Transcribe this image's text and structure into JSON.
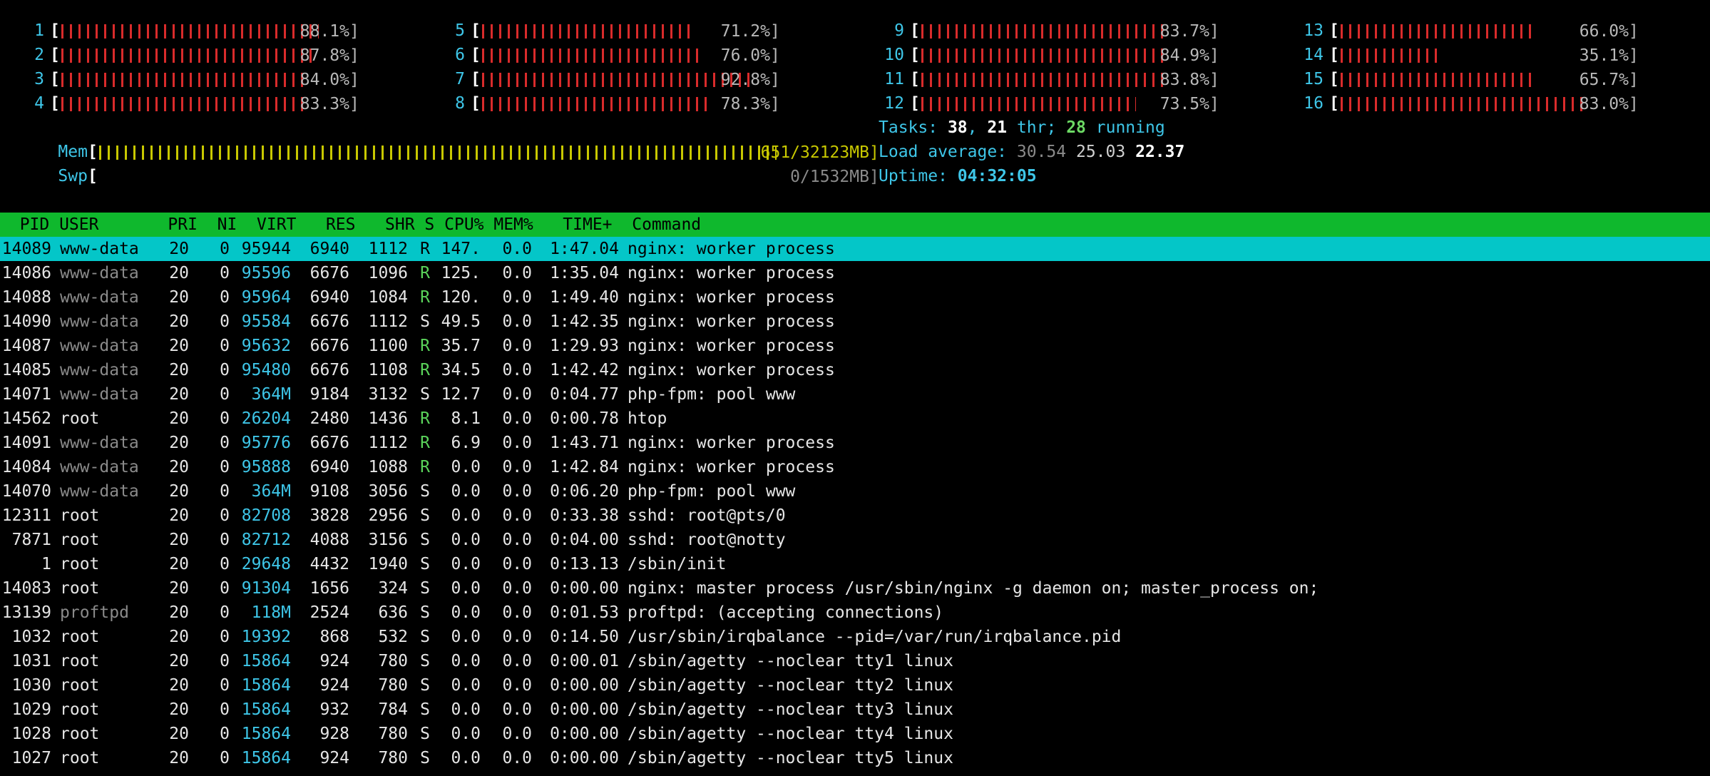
{
  "cpus": [
    {
      "n": "1",
      "pct": "88.1%]",
      "fill": 0.881
    },
    {
      "n": "2",
      "pct": "87.8%]",
      "fill": 0.878
    },
    {
      "n": "3",
      "pct": "84.0%]",
      "fill": 0.84
    },
    {
      "n": "4",
      "pct": "83.3%]",
      "fill": 0.833
    },
    {
      "n": "5",
      "pct": "71.2%]",
      "fill": 0.712
    },
    {
      "n": "6",
      "pct": "76.0%]",
      "fill": 0.76
    },
    {
      "n": "7",
      "pct": "92.8%]",
      "fill": 0.928
    },
    {
      "n": "8",
      "pct": "78.3%]",
      "fill": 0.783
    },
    {
      "n": "9",
      "pct": "83.7%]",
      "fill": 0.837
    },
    {
      "n": "10",
      "pct": "84.9%]",
      "fill": 0.849
    },
    {
      "n": "11",
      "pct": "83.8%]",
      "fill": 0.838
    },
    {
      "n": "12",
      "pct": "73.5%]",
      "fill": 0.735
    },
    {
      "n": "13",
      "pct": "66.0%]",
      "fill": 0.66
    },
    {
      "n": "14",
      "pct": "35.1%]",
      "fill": 0.351
    },
    {
      "n": "15",
      "pct": "65.7%]",
      "fill": 0.657
    },
    {
      "n": "16",
      "pct": "83.0%]",
      "fill": 0.83
    }
  ],
  "mem": {
    "label": "Mem",
    "value": "651/32123MB]",
    "fill": 0.99
  },
  "swp": {
    "label": "Swp",
    "value": "0/1532MB]",
    "fill": 0
  },
  "tasks": {
    "label": "Tasks:",
    "count": "38",
    "sep": ",",
    "thr": "21",
    "thr_label": "thr;",
    "running": "28",
    "running_label": "running"
  },
  "load": {
    "label": "Load average:",
    "l1": "30.54",
    "l5": "25.03",
    "l15": "22.37"
  },
  "uptime": {
    "label": "Uptime:",
    "value": "04:32:05"
  },
  "header": {
    "text": "  PID USER       PRI  NI  VIRT   RES   SHR S CPU% MEM%   TIME+  Command"
  },
  "processes": [
    {
      "pid": "14089",
      "user": "www-data",
      "pri": "20",
      "ni": "0",
      "virt": "95944",
      "res": "6940",
      "shr": "1112",
      "s": "R",
      "cpu": "147.",
      "mem": "0.0",
      "time": "1:47.04",
      "cmd": "nginx: worker process"
    },
    {
      "pid": "14086",
      "user": "www-data",
      "pri": "20",
      "ni": "0",
      "virt": "95596",
      "res": "6676",
      "shr": "1096",
      "s": "R",
      "cpu": "125.",
      "mem": "0.0",
      "time": "1:35.04",
      "cmd": "nginx: worker process"
    },
    {
      "pid": "14088",
      "user": "www-data",
      "pri": "20",
      "ni": "0",
      "virt": "95964",
      "res": "6940",
      "shr": "1084",
      "s": "R",
      "cpu": "120.",
      "mem": "0.0",
      "time": "1:49.40",
      "cmd": "nginx: worker process"
    },
    {
      "pid": "14090",
      "user": "www-data",
      "pri": "20",
      "ni": "0",
      "virt": "95584",
      "res": "6676",
      "shr": "1112",
      "s": "S",
      "cpu": "49.5",
      "mem": "0.0",
      "time": "1:42.35",
      "cmd": "nginx: worker process"
    },
    {
      "pid": "14087",
      "user": "www-data",
      "pri": "20",
      "ni": "0",
      "virt": "95632",
      "res": "6676",
      "shr": "1100",
      "s": "R",
      "cpu": "35.7",
      "mem": "0.0",
      "time": "1:29.93",
      "cmd": "nginx: worker process"
    },
    {
      "pid": "14085",
      "user": "www-data",
      "pri": "20",
      "ni": "0",
      "virt": "95480",
      "res": "6676",
      "shr": "1108",
      "s": "R",
      "cpu": "34.5",
      "mem": "0.0",
      "time": "1:42.42",
      "cmd": "nginx: worker process"
    },
    {
      "pid": "14071",
      "user": "www-data",
      "pri": "20",
      "ni": "0",
      "virt": "364M",
      "res": "9184",
      "shr": "3132",
      "s": "S",
      "cpu": "12.7",
      "mem": "0.0",
      "time": "0:04.77",
      "cmd": "php-fpm: pool www"
    },
    {
      "pid": "14562",
      "user": "root",
      "pri": "20",
      "ni": "0",
      "virt": "26204",
      "res": "2480",
      "shr": "1436",
      "s": "R",
      "cpu": "8.1",
      "mem": "0.0",
      "time": "0:00.78",
      "cmd": "htop"
    },
    {
      "pid": "14091",
      "user": "www-data",
      "pri": "20",
      "ni": "0",
      "virt": "95776",
      "res": "6676",
      "shr": "1112",
      "s": "R",
      "cpu": "6.9",
      "mem": "0.0",
      "time": "1:43.71",
      "cmd": "nginx: worker process"
    },
    {
      "pid": "14084",
      "user": "www-data",
      "pri": "20",
      "ni": "0",
      "virt": "95888",
      "res": "6940",
      "shr": "1088",
      "s": "R",
      "cpu": "0.0",
      "mem": "0.0",
      "time": "1:42.84",
      "cmd": "nginx: worker process"
    },
    {
      "pid": "14070",
      "user": "www-data",
      "pri": "20",
      "ni": "0",
      "virt": "364M",
      "res": "9108",
      "shr": "3056",
      "s": "S",
      "cpu": "0.0",
      "mem": "0.0",
      "time": "0:06.20",
      "cmd": "php-fpm: pool www"
    },
    {
      "pid": "12311",
      "user": "root",
      "pri": "20",
      "ni": "0",
      "virt": "82708",
      "res": "3828",
      "shr": "2956",
      "s": "S",
      "cpu": "0.0",
      "mem": "0.0",
      "time": "0:33.38",
      "cmd": "sshd: root@pts/0"
    },
    {
      "pid": "7871",
      "user": "root",
      "pri": "20",
      "ni": "0",
      "virt": "82712",
      "res": "4088",
      "shr": "3156",
      "s": "S",
      "cpu": "0.0",
      "mem": "0.0",
      "time": "0:04.00",
      "cmd": "sshd: root@notty"
    },
    {
      "pid": "1",
      "user": "root",
      "pri": "20",
      "ni": "0",
      "virt": "29648",
      "res": "4432",
      "shr": "1940",
      "s": "S",
      "cpu": "0.0",
      "mem": "0.0",
      "time": "0:13.13",
      "cmd": "/sbin/init"
    },
    {
      "pid": "14083",
      "user": "root",
      "pri": "20",
      "ni": "0",
      "virt": "91304",
      "res": "1656",
      "shr": "324",
      "s": "S",
      "cpu": "0.0",
      "mem": "0.0",
      "time": "0:00.00",
      "cmd": "nginx: master process /usr/sbin/nginx -g daemon on; master_process on;"
    },
    {
      "pid": "13139",
      "user": "proftpd",
      "pri": "20",
      "ni": "0",
      "virt": "118M",
      "res": "2524",
      "shr": "636",
      "s": "S",
      "cpu": "0.0",
      "mem": "0.0",
      "time": "0:01.53",
      "cmd": "proftpd: (accepting connections)"
    },
    {
      "pid": "1032",
      "user": "root",
      "pri": "20",
      "ni": "0",
      "virt": "19392",
      "res": "868",
      "shr": "532",
      "s": "S",
      "cpu": "0.0",
      "mem": "0.0",
      "time": "0:14.50",
      "cmd": "/usr/sbin/irqbalance --pid=/var/run/irqbalance.pid"
    },
    {
      "pid": "1031",
      "user": "root",
      "pri": "20",
      "ni": "0",
      "virt": "15864",
      "res": "924",
      "shr": "780",
      "s": "S",
      "cpu": "0.0",
      "mem": "0.0",
      "time": "0:00.01",
      "cmd": "/sbin/agetty --noclear tty1 linux"
    },
    {
      "pid": "1030",
      "user": "root",
      "pri": "20",
      "ni": "0",
      "virt": "15864",
      "res": "924",
      "shr": "780",
      "s": "S",
      "cpu": "0.0",
      "mem": "0.0",
      "time": "0:00.00",
      "cmd": "/sbin/agetty --noclear tty2 linux"
    },
    {
      "pid": "1029",
      "user": "root",
      "pri": "20",
      "ni": "0",
      "virt": "15864",
      "res": "932",
      "shr": "784",
      "s": "S",
      "cpu": "0.0",
      "mem": "0.0",
      "time": "0:00.00",
      "cmd": "/sbin/agetty --noclear tty3 linux"
    },
    {
      "pid": "1028",
      "user": "root",
      "pri": "20",
      "ni": "0",
      "virt": "15864",
      "res": "928",
      "shr": "780",
      "s": "S",
      "cpu": "0.0",
      "mem": "0.0",
      "time": "0:00.00",
      "cmd": "/sbin/agetty --noclear tty4 linux"
    },
    {
      "pid": "1027",
      "user": "root",
      "pri": "20",
      "ni": "0",
      "virt": "15864",
      "res": "924",
      "shr": "780",
      "s": "S",
      "cpu": "0.0",
      "mem": "0.0",
      "time": "0:00.00",
      "cmd": "/sbin/agetty --noclear tty5 linux"
    }
  ],
  "colors": {
    "bar": "#d92b2b",
    "label": "#3ec6e8",
    "header_bg": "#0fb82d",
    "selected_bg": "#04c6c8",
    "mem_bar": "#c8c800",
    "running": "#5ad35a"
  }
}
